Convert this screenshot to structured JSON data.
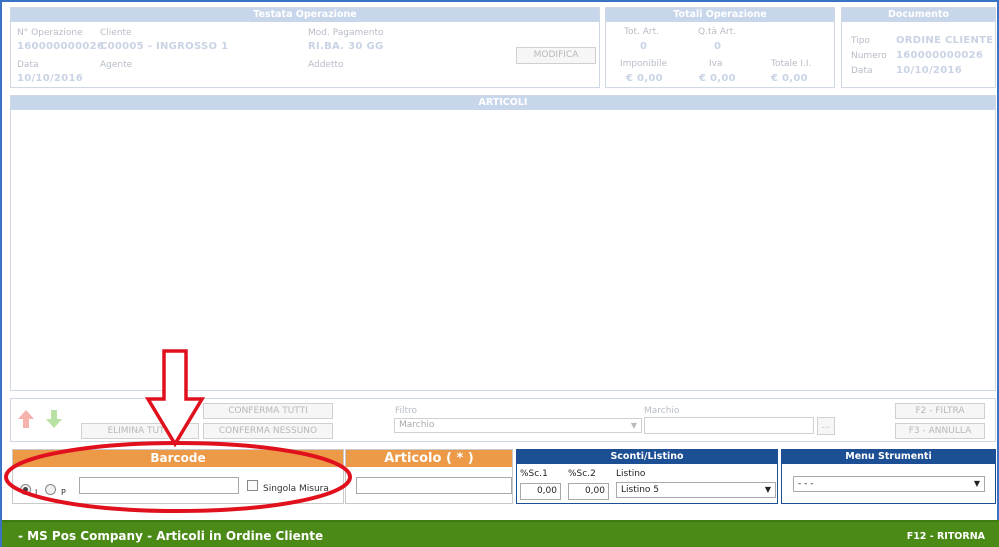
{
  "testata": {
    "title": "Testata Operazione",
    "n_operazione_label": "N° Operazione",
    "n_operazione_value": "160000000026",
    "cliente_label": "Cliente",
    "cliente_value": "C00005 - INGROSSO 1",
    "mod_pagamento_label": "Mod. Pagamento",
    "mod_pagamento_value": "RI.BA. 30 GG",
    "data_label": "Data",
    "data_value": "10/10/2016",
    "agente_label": "Agente",
    "addetto_label": "Addetto",
    "modifica_label": "MODIFICA"
  },
  "totali": {
    "title": "Totali Operazione",
    "tot_art_label": "Tot. Art.",
    "tot_art_value": "0",
    "qta_art_label": "Q.tà Art.",
    "qta_art_value": "0",
    "imponibile_label": "Imponibile",
    "imponibile_value": "€ 0,00",
    "iva_label": "Iva",
    "iva_value": "€ 0,00",
    "totale_label": "Totale I.I.",
    "totale_value": "€ 0,00"
  },
  "documento": {
    "title": "Documento",
    "tipo_label": "Tipo",
    "tipo_value": "ORDINE CLIENTE",
    "numero_label": "Numero",
    "numero_value": "160000000026",
    "data_label": "Data",
    "data_value": "10/10/2016"
  },
  "articoli": {
    "title": "ARTICOLI"
  },
  "actions": {
    "conferma_tutti": "CONFERMA TUTTI",
    "elimina_tutti": "ELIMINA TUTTI",
    "conferma_nessuno": "CONFERMA NESSUNO",
    "filtro_label": "Filtro",
    "filtro_value": "Marchio",
    "marchio_label": "Marchio",
    "browse_label": "...",
    "filtra_label": "F2 - FILTRA",
    "annulla_label": "F3 - ANNULLA"
  },
  "barcode": {
    "title": "Barcode",
    "radio_i": "I",
    "radio_p": "P",
    "singola_misura": "Singola Misura"
  },
  "articolo": {
    "title": "Articolo ( * )"
  },
  "sconti": {
    "title": "Sconti/Listino",
    "sc1_label": "%Sc.1",
    "sc1_value": "0,00",
    "sc2_label": "%Sc.2",
    "sc2_value": "0,00",
    "listino_label": "Listino",
    "listino_value": "Listino 5"
  },
  "menu_strumenti": {
    "title": "Menu Strumenti",
    "value": "- - -"
  },
  "footer": {
    "title": "- MS Pos Company - Articoli in Ordine Cliente",
    "ritorna": "F12 - RITORNA"
  },
  "colors": {
    "accent_blue": "#1c4f93",
    "orange": "#ec9a48",
    "footer_green": "#4b8a17",
    "highlight_red": "#e0101c"
  }
}
